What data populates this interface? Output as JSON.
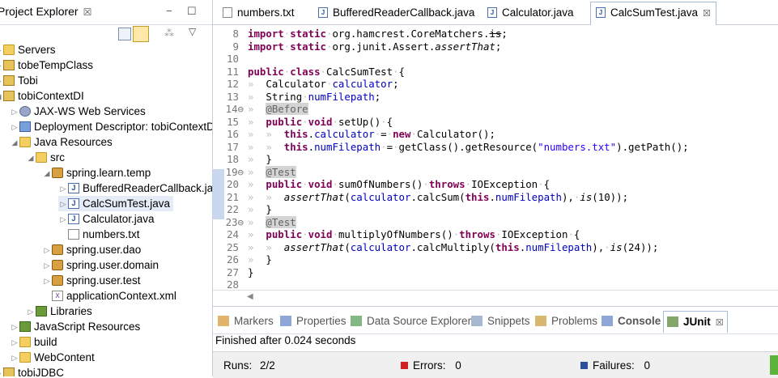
{
  "project_explorer": {
    "title": "Project Explorer",
    "close_glyph": "☒",
    "minimize_glyph": "−",
    "maximize_glyph": "☐",
    "menu_glyph": "▽",
    "tree": [
      {
        "label": "Servers",
        "icon": "folder-icon",
        "indent": 0,
        "twisty": "▷"
      },
      {
        "label": "tobeTempClass",
        "icon": "project-icon",
        "indent": 0,
        "twisty": "▷"
      },
      {
        "label": "Tobi",
        "icon": "project-icon",
        "indent": 0,
        "twisty": "▷"
      },
      {
        "label": "tobiContextDI",
        "icon": "project-icon",
        "indent": 0,
        "twisty": "◢"
      },
      {
        "label": "JAX-WS Web Services",
        "icon": "web-services-icon",
        "indent": 1,
        "twisty": "▷"
      },
      {
        "label": "Deployment Descriptor: tobiContextDI",
        "icon": "deployment-descriptor-icon",
        "indent": 1,
        "twisty": "▷"
      },
      {
        "label": "Java Resources",
        "icon": "java-resources-icon",
        "indent": 1,
        "twisty": "◢"
      },
      {
        "label": "src",
        "icon": "source-folder-icon",
        "indent": 2,
        "twisty": "◢"
      },
      {
        "label": "spring.learn.temp",
        "icon": "package-icon",
        "indent": 3,
        "twisty": "◢"
      },
      {
        "label": "BufferedReaderCallback.java",
        "icon": "java-file-icon",
        "indent": 4,
        "twisty": "▷"
      },
      {
        "label": "CalcSumTest.java",
        "icon": "java-file-icon",
        "indent": 4,
        "twisty": "▷",
        "selected": true
      },
      {
        "label": "Calculator.java",
        "icon": "java-file-icon",
        "indent": 4,
        "twisty": "▷"
      },
      {
        "label": "numbers.txt",
        "icon": "text-file-icon",
        "indent": 4,
        "twisty": ""
      },
      {
        "label": "spring.user.dao",
        "icon": "package-icon",
        "indent": 3,
        "twisty": "▷"
      },
      {
        "label": "spring.user.domain",
        "icon": "package-icon",
        "indent": 3,
        "twisty": "▷"
      },
      {
        "label": "spring.user.test",
        "icon": "package-icon",
        "indent": 3,
        "twisty": "▷"
      },
      {
        "label": "applicationContext.xml",
        "icon": "xml-file-icon",
        "indent": 3,
        "twisty": ""
      },
      {
        "label": "Libraries",
        "icon": "libraries-icon",
        "indent": 2,
        "twisty": "▷"
      },
      {
        "label": "JavaScript Resources",
        "icon": "javascript-resources-icon",
        "indent": 1,
        "twisty": "▷"
      },
      {
        "label": "build",
        "icon": "folder-icon",
        "indent": 1,
        "twisty": "▷"
      },
      {
        "label": "WebContent",
        "icon": "folder-icon",
        "indent": 1,
        "twisty": "▷"
      },
      {
        "label": "tobiJDBC",
        "icon": "project-icon",
        "indent": 0,
        "twisty": "▷"
      }
    ]
  },
  "editor": {
    "tabs": [
      {
        "label": "numbers.txt",
        "icon": "text-file-icon",
        "active": false
      },
      {
        "label": "BufferedReaderCallback.java",
        "icon": "java-file-icon",
        "active": false
      },
      {
        "label": "Calculator.java",
        "icon": "java-file-icon",
        "active": false
      },
      {
        "label": "CalcSumTest.java",
        "icon": "java-file-icon",
        "active": true,
        "close": "☒"
      }
    ],
    "code_lines": [
      {
        "n": "8",
        "marker": "",
        "segs": [
          [
            "kw",
            "import"
          ],
          [
            "ws",
            "·"
          ],
          [
            "kw",
            "static"
          ],
          [
            "ws",
            "·"
          ],
          [
            "",
            "org.hamcrest.CoreMatchers."
          ],
          [
            "strike",
            "is"
          ],
          [
            "",
            ";"
          ]
        ]
      },
      {
        "n": "9",
        "marker": "",
        "segs": [
          [
            "kw",
            "import"
          ],
          [
            "ws",
            "·"
          ],
          [
            "kw",
            "static"
          ],
          [
            "ws",
            "·"
          ],
          [
            "",
            "org.junit.Assert."
          ],
          [
            "it",
            "assertThat"
          ],
          [
            "",
            ";"
          ]
        ]
      },
      {
        "n": "10",
        "marker": "",
        "segs": []
      },
      {
        "n": "11",
        "marker": "",
        "segs": [
          [
            "kw",
            "public"
          ],
          [
            "ws",
            "·"
          ],
          [
            "kw",
            "class"
          ],
          [
            "ws",
            "·"
          ],
          [
            "",
            "CalcSumTest"
          ],
          [
            "ws",
            "·"
          ],
          [
            "",
            "{"
          ]
        ]
      },
      {
        "n": "12",
        "marker": "",
        "segs": [
          [
            "ws",
            "»  "
          ],
          [
            "",
            "Calculator"
          ],
          [
            "ws",
            "·"
          ],
          [
            "fld",
            "calculator"
          ],
          [
            "",
            ";"
          ]
        ]
      },
      {
        "n": "13",
        "marker": "",
        "segs": [
          [
            "ws",
            "»  "
          ],
          [
            "",
            "String"
          ],
          [
            "ws",
            "·"
          ],
          [
            "fld",
            "numFilepath"
          ],
          [
            "",
            ";"
          ]
        ]
      },
      {
        "n": "14",
        "marker": "⊖",
        "segs": [
          [
            "ws",
            "»  "
          ],
          [
            "ann",
            "@Before"
          ]
        ]
      },
      {
        "n": "15",
        "marker": "",
        "segs": [
          [
            "ws",
            "»  "
          ],
          [
            "kw",
            "public"
          ],
          [
            "ws",
            "·"
          ],
          [
            "kw",
            "void"
          ],
          [
            "ws",
            "·"
          ],
          [
            "",
            "setUp()"
          ],
          [
            "ws",
            "·"
          ],
          [
            "",
            "{"
          ]
        ]
      },
      {
        "n": "16",
        "marker": "",
        "segs": [
          [
            "ws",
            "»  »  "
          ],
          [
            "kw",
            "this"
          ],
          [
            "",
            "."
          ],
          [
            "fld",
            "calculator"
          ],
          [
            "ws",
            "·"
          ],
          [
            "",
            "="
          ],
          [
            "ws",
            "·"
          ],
          [
            "kw",
            "new"
          ],
          [
            "ws",
            "·"
          ],
          [
            "",
            "Calculator();"
          ]
        ]
      },
      {
        "n": "17",
        "marker": "",
        "segs": [
          [
            "ws",
            "»  »  "
          ],
          [
            "kw",
            "this"
          ],
          [
            "",
            "."
          ],
          [
            "fld",
            "numFilepath"
          ],
          [
            "ws",
            "·"
          ],
          [
            "",
            "="
          ],
          [
            "ws",
            "·"
          ],
          [
            "",
            "getClass().getResource("
          ],
          [
            "str",
            "\"numbers.txt\""
          ],
          [
            "",
            ").getPath();"
          ]
        ]
      },
      {
        "n": "18",
        "marker": "",
        "segs": [
          [
            "ws",
            "»  "
          ],
          [
            "",
            "}"
          ]
        ]
      },
      {
        "n": "19",
        "marker": "⊖",
        "segs": [
          [
            "ws",
            "»  "
          ],
          [
            "ann",
            "@Test"
          ]
        ]
      },
      {
        "n": "20",
        "marker": "",
        "segs": [
          [
            "ws",
            "»  "
          ],
          [
            "kw",
            "public"
          ],
          [
            "ws",
            "·"
          ],
          [
            "kw",
            "void"
          ],
          [
            "ws",
            "·"
          ],
          [
            "",
            "sumOfNumbers()"
          ],
          [
            "ws",
            "·"
          ],
          [
            "kw",
            "throws"
          ],
          [
            "ws",
            "·"
          ],
          [
            "",
            "IOException"
          ],
          [
            "ws",
            "·"
          ],
          [
            "",
            "{"
          ]
        ]
      },
      {
        "n": "21",
        "marker": "",
        "segs": [
          [
            "ws",
            "»  »  "
          ],
          [
            "it",
            "assertThat"
          ],
          [
            "",
            "("
          ],
          [
            "fld",
            "calculator"
          ],
          [
            "",
            ".calcSum("
          ],
          [
            "kw",
            "this"
          ],
          [
            "",
            "."
          ],
          [
            "fld",
            "numFilepath"
          ],
          [
            "",
            "),"
          ],
          [
            "ws",
            "·"
          ],
          [
            "it",
            "is"
          ],
          [
            "",
            "(10));"
          ]
        ]
      },
      {
        "n": "22",
        "marker": "",
        "segs": [
          [
            "ws",
            "»  "
          ],
          [
            "",
            "}"
          ]
        ]
      },
      {
        "n": "23",
        "marker": "⊖",
        "segs": [
          [
            "ws",
            "»  "
          ],
          [
            "ann",
            "@Test"
          ]
        ]
      },
      {
        "n": "24",
        "marker": "",
        "segs": [
          [
            "ws",
            "»  "
          ],
          [
            "kw",
            "public"
          ],
          [
            "ws",
            "·"
          ],
          [
            "kw",
            "void"
          ],
          [
            "ws",
            "·"
          ],
          [
            "",
            "multiplyOfNumbers()"
          ],
          [
            "ws",
            "·"
          ],
          [
            "kw",
            "throws"
          ],
          [
            "ws",
            "·"
          ],
          [
            "",
            "IOException"
          ],
          [
            "ws",
            "·"
          ],
          [
            "",
            "{"
          ]
        ]
      },
      {
        "n": "25",
        "marker": "",
        "segs": [
          [
            "ws",
            "»  »  "
          ],
          [
            "it",
            "assertThat"
          ],
          [
            "",
            "("
          ],
          [
            "fld",
            "calculator"
          ],
          [
            "",
            ".calcMultiply("
          ],
          [
            "kw",
            "this"
          ],
          [
            "",
            "."
          ],
          [
            "fld",
            "numFilepath"
          ],
          [
            "",
            "),"
          ],
          [
            "ws",
            "·"
          ],
          [
            "it",
            "is"
          ],
          [
            "",
            "(24));"
          ]
        ]
      },
      {
        "n": "26",
        "marker": "",
        "segs": [
          [
            "ws",
            "»  "
          ],
          [
            "",
            "}"
          ]
        ]
      },
      {
        "n": "27",
        "marker": "",
        "segs": [
          [
            "",
            "}"
          ]
        ]
      },
      {
        "n": "28",
        "marker": "",
        "segs": []
      }
    ],
    "scroll_left_glyph": "◀"
  },
  "bottom_panel": {
    "tabs": [
      {
        "label": "Markers",
        "icon": "markers-icon",
        "active": false
      },
      {
        "label": "Properties",
        "icon": "properties-icon",
        "active": false
      },
      {
        "label": "Data Source Explorer",
        "icon": "data-source-explorer-icon",
        "active": false
      },
      {
        "label": "Snippets",
        "icon": "snippets-icon",
        "active": false
      },
      {
        "label": "Problems",
        "icon": "problems-icon",
        "active": false
      },
      {
        "label": "Console",
        "icon": "console-icon",
        "active": false
      },
      {
        "label": "JUnit",
        "icon": "junit-icon",
        "active": true,
        "close": "☒"
      }
    ],
    "finished_text": "Finished after 0.024 seconds",
    "runs_label": "Runs:",
    "runs_value": "2/2",
    "errors_label": "Errors:",
    "errors_value": "0",
    "failures_label": "Failures:",
    "failures_value": "0",
    "progress_color": "#5ab33a",
    "errors_icon_color": "#d02020",
    "failures_icon_color": "#2a4f9c"
  }
}
